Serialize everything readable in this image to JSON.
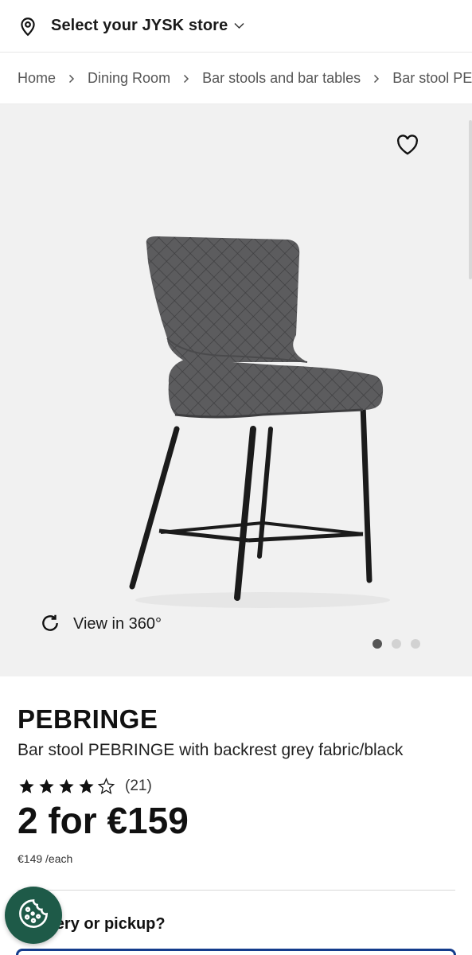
{
  "header": {
    "store_label": "Select your JYSK store",
    "icons": {
      "location": "location-pin-icon",
      "dropdown": "chevron-down-icon"
    }
  },
  "breadcrumb": {
    "items": [
      "Home",
      "Dining Room",
      "Bar stools and bar tables",
      "Bar stool PEBRINGE"
    ]
  },
  "gallery": {
    "view_360_label": "View in 360°",
    "slide_count": 3,
    "active_slide": 1,
    "icons": {
      "favorite": "heart-icon",
      "rotate": "rotate-360-icon"
    }
  },
  "product": {
    "brand": "PEBRINGE",
    "description": "Bar stool PEBRINGE with backrest grey fabric/black",
    "rating": 4,
    "rating_max": 5,
    "review_count": "(21)",
    "price": "2 for €159",
    "unit_price": "€149 /each"
  },
  "delivery": {
    "question": "Delivery or pickup?"
  },
  "colors": {
    "accent_blue": "#143c8c",
    "cookie_green": "#1e5a48",
    "gallery_bg": "#f1f1f1"
  }
}
